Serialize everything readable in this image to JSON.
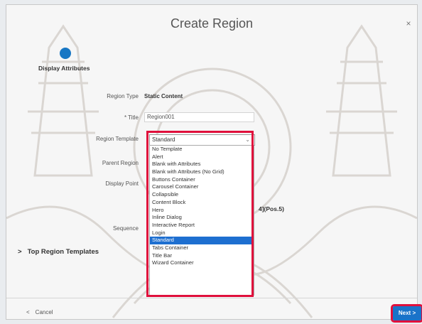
{
  "dialog": {
    "title": "Create Region",
    "close_label": "×",
    "step_label": "Display Attributes"
  },
  "form": {
    "region_type_label": "Region Type",
    "region_type_value": "Static Content",
    "title_label": "* Title",
    "title_value": "Region001",
    "region_template_label": "Region Template",
    "region_template_value": "Standard",
    "parent_region_label": "Parent Region",
    "display_point_label": "Display Point",
    "display_point_tail": "4](Pos.5)",
    "sequence_label": "Sequence"
  },
  "dropdown": {
    "options": [
      "No Template",
      "Alert",
      "Blank with Attributes",
      "Blank with Attributes (No Grid)",
      "Buttons Container",
      "Carousel Container",
      "Collapsible",
      "Content Block",
      "Hero",
      "Inline Dialog",
      "Interactive Report",
      "Login",
      "Standard",
      "Tabs Container",
      "Title Bar",
      "Wizard Container"
    ],
    "selected_index": 12
  },
  "section": {
    "chevron": ">",
    "label": "Top Region Templates"
  },
  "footer": {
    "cancel_arrow": "<",
    "cancel_label": "Cancel",
    "next_label": "Next",
    "next_arrow": ">"
  },
  "colors": {
    "accent": "#1a73c9",
    "highlight": "#e0103c",
    "selected": "#1e6fd0"
  }
}
